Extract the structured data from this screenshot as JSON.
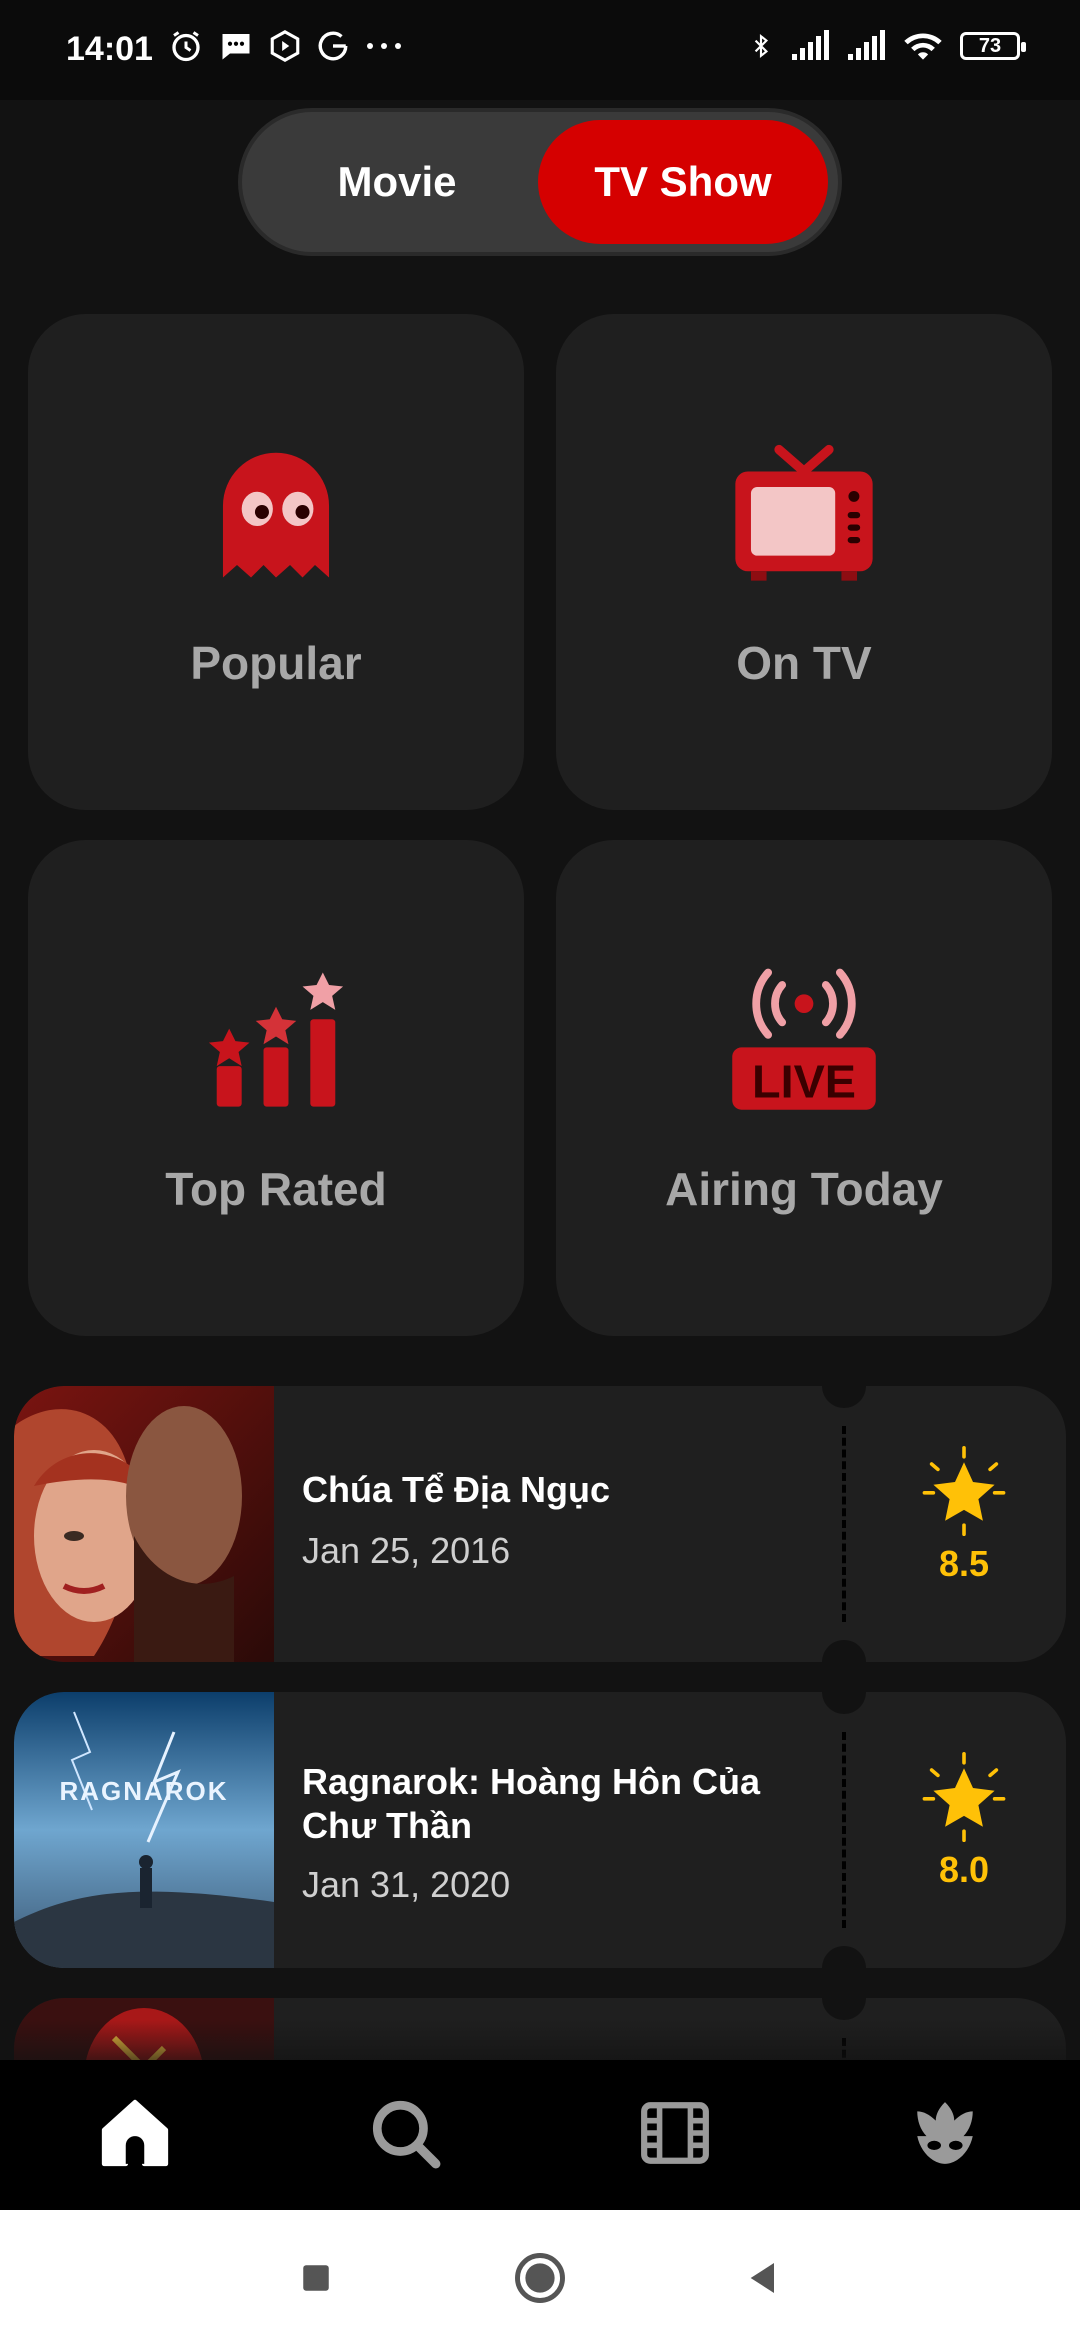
{
  "status_bar": {
    "time": "14:01",
    "battery": "73"
  },
  "toggle": {
    "movie_label": "Movie",
    "tv_label": "TV Show",
    "selected": "TV Show"
  },
  "categories": [
    {
      "label": "Popular",
      "icon": "ghost-icon"
    },
    {
      "label": "On TV",
      "icon": "tv-icon"
    },
    {
      "label": "Top Rated",
      "icon": "top-rated-chart-icon"
    },
    {
      "label": "Airing Today",
      "icon": "live-broadcast-icon"
    }
  ],
  "shows": [
    {
      "title": "Chúa Tể Địa Ngục",
      "date": "Jan 25, 2016",
      "rating": "8.5"
    },
    {
      "title": "Ragnarok: Hoàng Hôn Của Chư Thần",
      "date": "Jan 31, 2020",
      "rating": "8.0"
    }
  ],
  "bottom_nav": [
    "home-icon",
    "search-icon",
    "film-icon",
    "mask-icon"
  ],
  "colors": {
    "accent": "#d50000",
    "star": "#ffc107",
    "tile": "#1f1f1f",
    "background": "#121212"
  }
}
